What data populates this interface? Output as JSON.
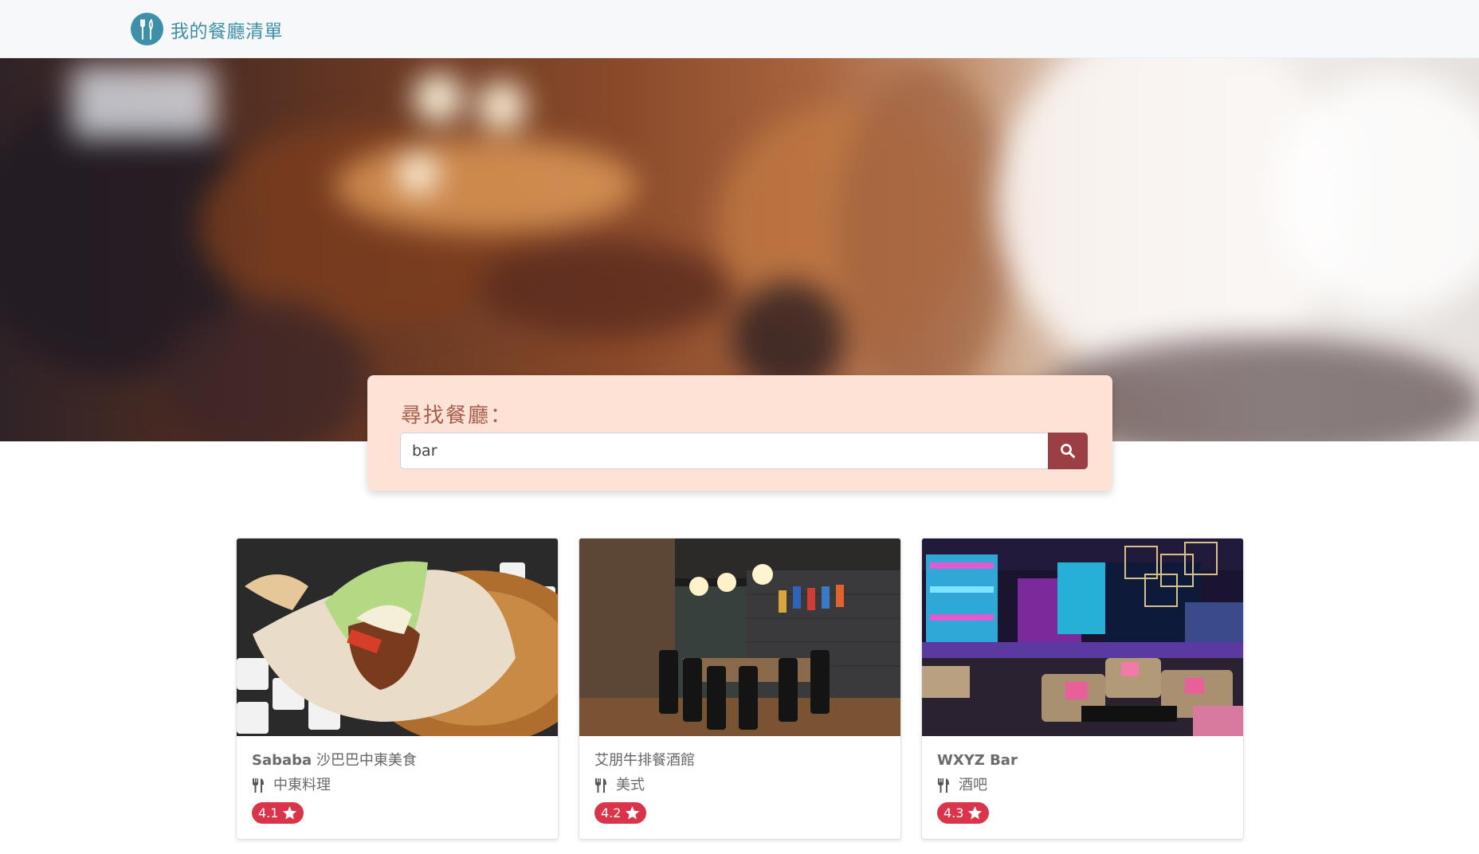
{
  "navbar": {
    "brand_label": "我的餐廳清單",
    "logo_icon": "fork-knife-icon",
    "logo_color": "#3f8fa8"
  },
  "search": {
    "title": "尋找餐廳：",
    "value": "bar",
    "button_icon": "search-icon",
    "accent": "#9b3f45"
  },
  "restaurants": [
    {
      "name_en": "Sababa",
      "name_zh": "沙巴巴中東美食",
      "category": "中東料理",
      "rating": "4.1",
      "category_icon": "utensils-icon",
      "rating_icon": "star-icon"
    },
    {
      "name_en": "",
      "name_zh": "艾朋牛排餐酒館",
      "category": "美式",
      "rating": "4.2",
      "category_icon": "utensils-icon",
      "rating_icon": "star-icon"
    },
    {
      "name_en": "WXYZ Bar",
      "name_zh": "",
      "category": "酒吧",
      "rating": "4.3",
      "category_icon": "utensils-icon",
      "rating_icon": "star-icon"
    }
  ],
  "colors": {
    "rating_badge": "#d9344a",
    "search_card_bg": "#fde2d5"
  }
}
